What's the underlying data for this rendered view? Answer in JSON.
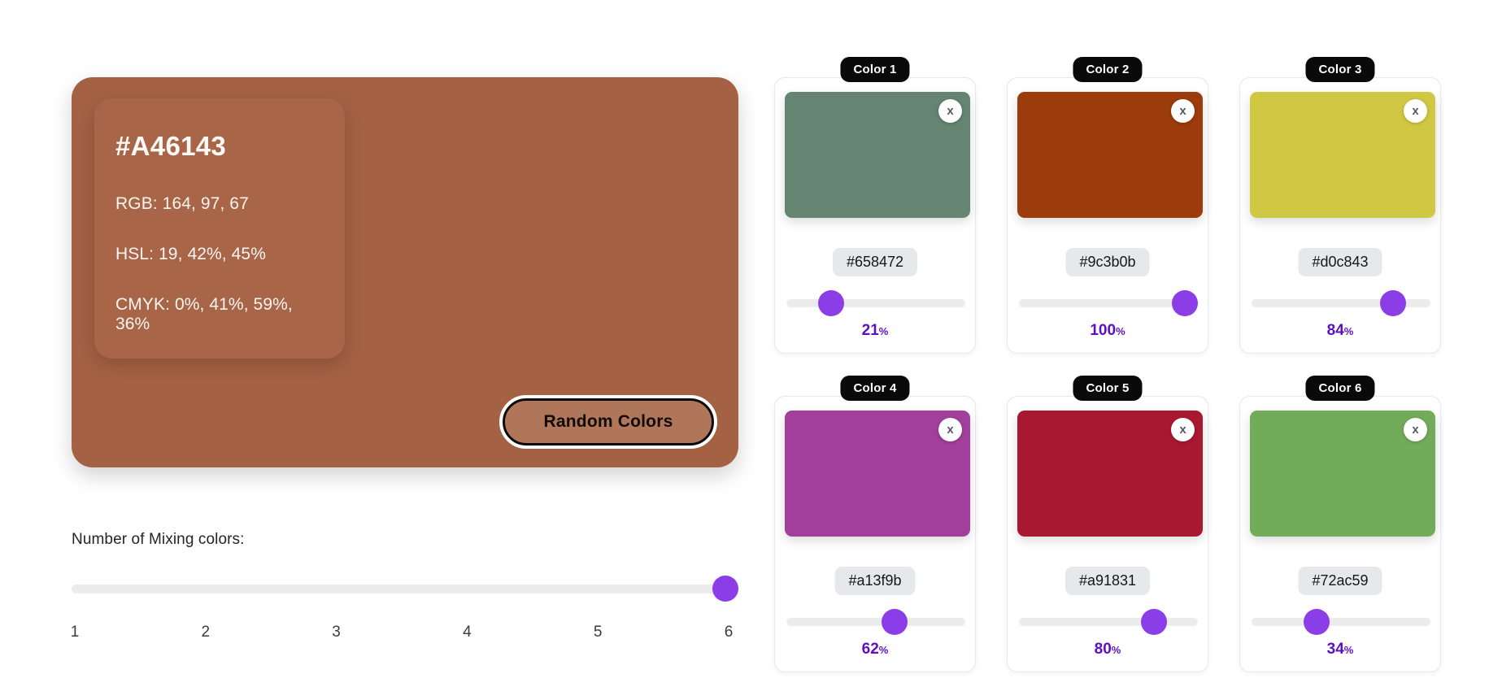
{
  "theme": {
    "page_bg": "#ffffff",
    "accent_purple": "#8b3ee8",
    "pct_text": "#5e0fc4",
    "badge_bg": "#0a0a0a",
    "chip_bg": "#e6e8ec",
    "track_bg": "#ececec"
  },
  "main_panel": {
    "background_color": "#a46143",
    "info_card_color": "#a86548",
    "hex": "#A46143",
    "rgb": "RGB: 164, 97, 67",
    "hsl": "HSL: 19, 42%, 45%",
    "cmyk": "CMYK: 0%, 41%, 59%, 36%",
    "random_button_label": "Random Colors"
  },
  "mixing": {
    "label": "Number of Mixing colors:",
    "value": 6,
    "min": 1,
    "max": 6,
    "ticks": [
      "1",
      "2",
      "3",
      "4",
      "5",
      "6"
    ]
  },
  "colors": [
    {
      "badge": "Color 1",
      "hex": "#658472",
      "swatch": "#658472",
      "percent": 21,
      "percent_text": "21",
      "percent_sign": "%",
      "close_label": "x"
    },
    {
      "badge": "Color 2",
      "hex": "#9c3b0b",
      "swatch": "#9c3b0b",
      "percent": 100,
      "percent_text": "100",
      "percent_sign": "%",
      "close_label": "x"
    },
    {
      "badge": "Color 3",
      "hex": "#d0c843",
      "swatch": "#d0c843",
      "percent": 84,
      "percent_text": "84",
      "percent_sign": "%",
      "close_label": "x"
    },
    {
      "badge": "Color 4",
      "hex": "#a13f9b",
      "swatch": "#a13f9b",
      "percent": 62,
      "percent_text": "62",
      "percent_sign": "%",
      "close_label": "x"
    },
    {
      "badge": "Color 5",
      "hex": "#a91831",
      "swatch": "#a91831",
      "percent": 80,
      "percent_text": "80",
      "percent_sign": "%",
      "close_label": "x"
    },
    {
      "badge": "Color 6",
      "hex": "#72ac59",
      "swatch": "#72ac59",
      "percent": 34,
      "percent_text": "34",
      "percent_sign": "%",
      "close_label": "x"
    }
  ]
}
